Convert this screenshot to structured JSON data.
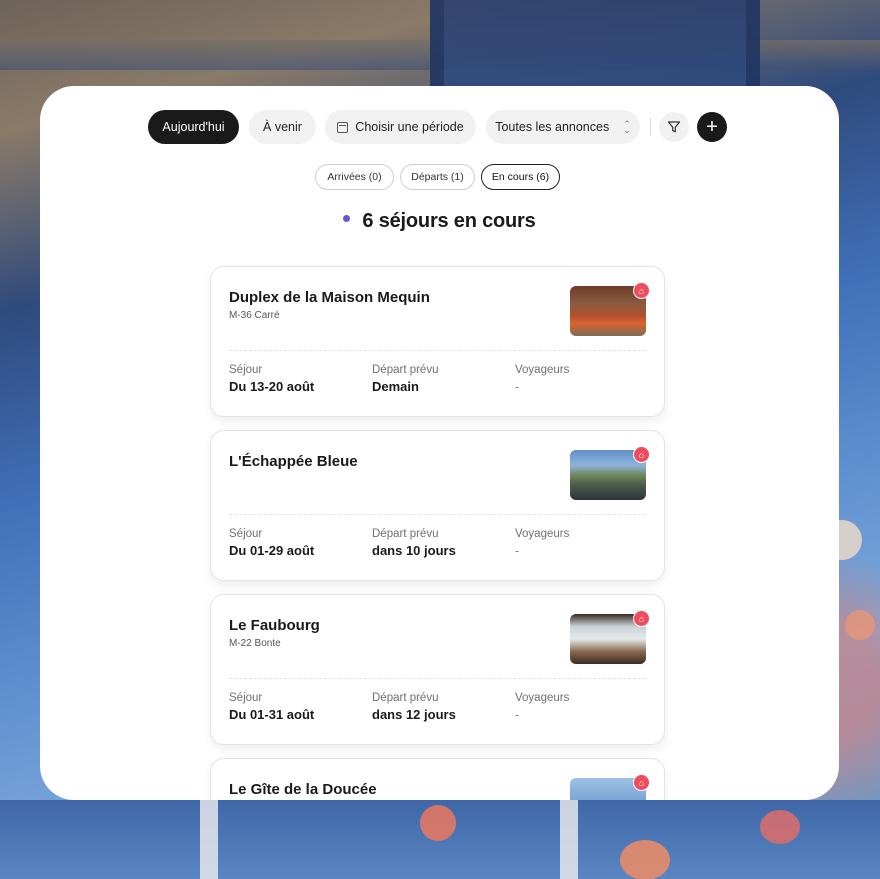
{
  "toolbar": {
    "today": "Aujourd'hui",
    "upcoming": "À venir",
    "period": "Choisir une période",
    "listings": "Toutes les annonces",
    "add": "+"
  },
  "subtabs": {
    "arrivals": "Arrivées (0)",
    "departures": "Départs (1)",
    "ongoing": "En cours (6)"
  },
  "heading": "6 séjours en cours",
  "labels": {
    "stay": "Séjour",
    "departure": "Départ prévu",
    "guests": "Voyageurs"
  },
  "cards": [
    {
      "title": "Duplex de la Maison Mequin",
      "subtitle": "M-36 Carré",
      "stay": "Du 13-20 août",
      "departure": "Demain",
      "guests": "-"
    },
    {
      "title": "L'Échappée Bleue",
      "subtitle": "",
      "stay": "Du 01-29 août",
      "departure": "dans 10 jours",
      "guests": "-"
    },
    {
      "title": "Le Faubourg",
      "subtitle": "M-22 Bonte",
      "stay": "Du 01-31 août",
      "departure": "dans 12 jours",
      "guests": "-"
    },
    {
      "title": "Le Gîte de la Doucée",
      "subtitle": "",
      "stay": "",
      "departure": "",
      "guests": ""
    }
  ],
  "colors": {
    "accent_dot": "#5b5bd6",
    "badge": "#ef4d5d",
    "active_pill": "#1a1a1a"
  },
  "icons": [
    "calendar-icon",
    "chevron-updown-icon",
    "filter-icon",
    "plus-icon",
    "airbnb-icon"
  ]
}
